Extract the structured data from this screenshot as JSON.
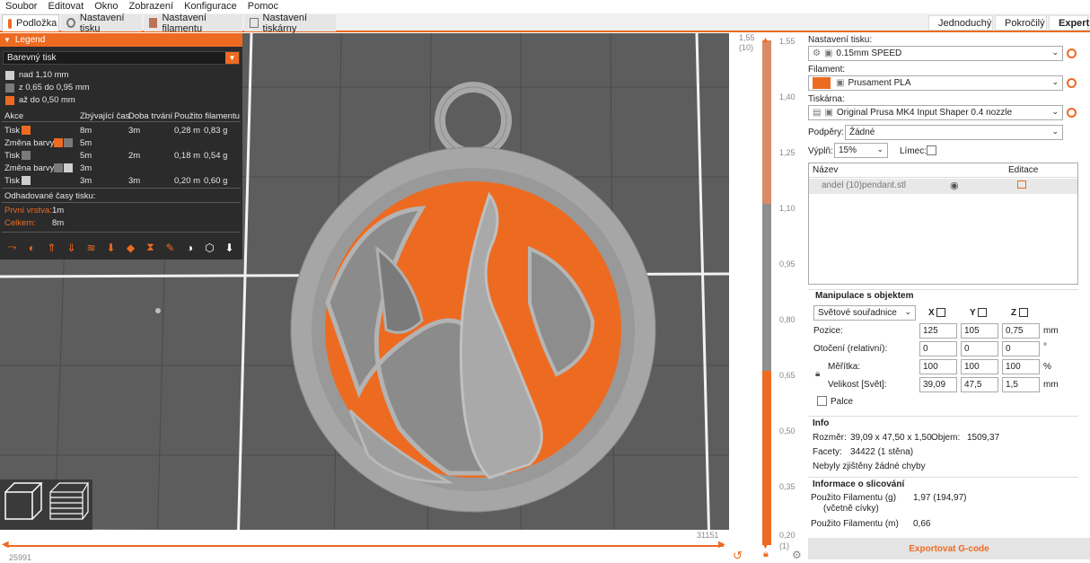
{
  "menu": [
    "Soubor",
    "Editovat",
    "Okno",
    "Zobrazení",
    "Konfigurace",
    "Pomoc"
  ],
  "tabs": {
    "plater": "Podložka",
    "print": "Nastavení tisku",
    "filament": "Nastavení filamentu",
    "printer": "Nastavení tiskárny"
  },
  "modes": {
    "simple": "Jednoduchý",
    "advanced": "Pokročilý",
    "expert": "Expert"
  },
  "colors": {
    "accent": "#ed6b21",
    "gray": "#9a9a9a",
    "dark_gray": "#6c6c6c",
    "white_swatch": "#cfcfcf",
    "simple_dot": "#5fc33b",
    "advanced_dot": "#f0c419",
    "expert_dot": "#e0001b"
  },
  "legend": {
    "title": "Legend",
    "view_type": "Barevný tisk",
    "ranges": [
      {
        "label": "nad 1,10 mm",
        "color": "#cfcfcf"
      },
      {
        "label": "z 0,65 do 0,95 mm",
        "color": "#7a7a7a"
      },
      {
        "label": "až do 0,50 mm",
        "color": "#ed6b21"
      }
    ],
    "headers": {
      "action": "Akce",
      "remaining": "Zbývající čas",
      "duration": "Doba trvání",
      "used": "Použito filamentu"
    },
    "rows": [
      {
        "action": "Tisk",
        "remaining": "8m",
        "duration": "3m",
        "length": "0,28 m",
        "weight": "0,83 g"
      },
      {
        "action": "Změna barvy",
        "remaining": "5m",
        "duration": "",
        "length": "",
        "weight": ""
      },
      {
        "action": "Tisk",
        "remaining": "5m",
        "duration": "2m",
        "length": "0,18 m",
        "weight": "0,54 g"
      },
      {
        "action": "Změna barvy",
        "remaining": "3m",
        "duration": "",
        "length": "",
        "weight": ""
      },
      {
        "action": "Tisk",
        "remaining": "3m",
        "duration": "3m",
        "length": "0,20 m",
        "weight": "0,60 g"
      }
    ],
    "estimated_label": "Odhadované časy tisku:",
    "first_layer_label": "První vrstva:",
    "first_layer": "1m",
    "total_label": "Celkem:",
    "total": "8m"
  },
  "hslider": {
    "left_value": "25991",
    "right_value": "31151"
  },
  "vslider": {
    "top": "1,55",
    "top_layer": "(10)",
    "bottom": "0,20",
    "bottom_layer": "(1)",
    "ticks": [
      "1,55",
      "1,40",
      "1,25",
      "1,10",
      "0,95",
      "0,80",
      "0,65",
      "0,50",
      "0,35",
      "0,20"
    ]
  },
  "sidebar": {
    "print_settings_label": "Nastavení tisku:",
    "print_settings": "0.15mm SPEED",
    "filament_label": "Filament:",
    "filament": "Prusament PLA",
    "printer_label": "Tiskárna:",
    "printer": "Original Prusa MK4 Input Shaper 0.4 nozzle",
    "supports_label": "Podpěry:",
    "supports": "Žádné",
    "infill_label": "Výplň:",
    "infill": "15%",
    "brim_label": "Límec:",
    "object_list": {
      "name_header": "Název",
      "edit_header": "Editace",
      "object": "andel (10)pendant.stl"
    },
    "manip": {
      "title": "Manipulace s objektem",
      "coords": "Světové souřadnice",
      "x": "X",
      "y": "Y",
      "z": "Z",
      "position_label": "Pozice:",
      "position": [
        "125",
        "105",
        "0,75"
      ],
      "pos_unit": "mm",
      "rotation_label": "Otočení (relativní):",
      "rotation": [
        "0",
        "0",
        "0"
      ],
      "rot_unit": "°",
      "scale_label": "Měřítka:",
      "scale": [
        "100",
        "100",
        "100"
      ],
      "scale_unit": "%",
      "size_label": "Velikost [Svět]:",
      "size": [
        "39,09",
        "47,5",
        "1,5"
      ],
      "size_unit": "mm",
      "inches_label": "Palce"
    },
    "info": {
      "title": "Info",
      "size_label": "Rozměr:",
      "size": "39,09 x 47,50 x 1,50",
      "volume_label": "Objem:",
      "volume": "1509,37",
      "facets_label": "Facety:",
      "facets": "34422 (1 stěna)",
      "errors": "Nebyly zjištěny žádné chyby"
    },
    "slice": {
      "title": "Informace o slicování",
      "used_g_label": "Použito Filamentu (g)",
      "used_g_sub": "(včetně cívky)",
      "used_g": "1,97 (194,97)",
      "used_m_label": "Použito Filamentu (m)",
      "used_m": "0,66"
    },
    "export": "Exportovat G-code"
  }
}
